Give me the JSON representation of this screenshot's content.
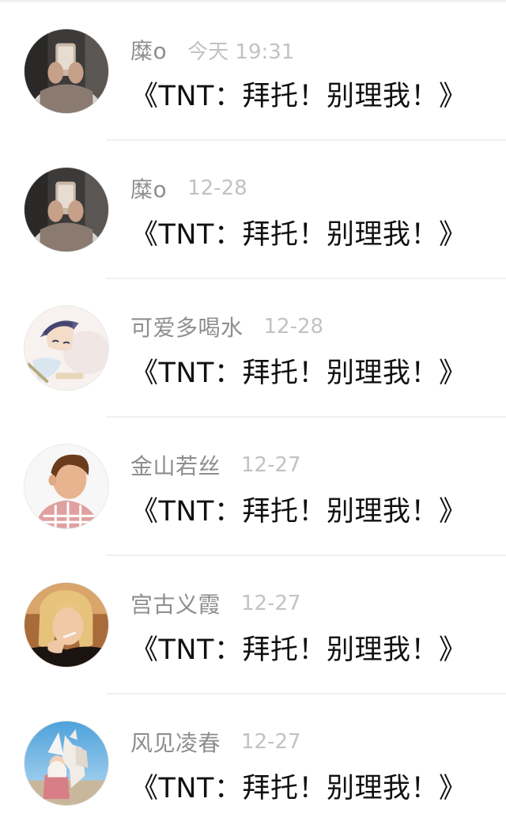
{
  "comments": [
    {
      "name": "糜o",
      "time": "今天 19:31",
      "message": "《TNT：拜托！别理我！》",
      "avatar": "avatar-photo-phone-selfie",
      "colors": {
        "bg": "#3f3d3b",
        "accent": "#b79a86"
      }
    },
    {
      "name": "糜o",
      "time": "12-28",
      "message": "《TNT：拜托！别理我！》",
      "avatar": "avatar-photo-phone-selfie",
      "colors": {
        "bg": "#3f3d3b",
        "accent": "#b79a86"
      }
    },
    {
      "name": "可爱多喝水",
      "time": "12-28",
      "message": "《TNT：拜托！别理我！》",
      "avatar": "avatar-anime-character",
      "colors": {
        "bg": "#f6f0ee",
        "accent": "#6a6f9a"
      }
    },
    {
      "name": "金山若丝",
      "time": "12-27",
      "message": "《TNT：拜托！别理我！》",
      "avatar": "avatar-photo-boy",
      "colors": {
        "bg": "#f6f6f6",
        "accent": "#d46a6a"
      }
    },
    {
      "name": "宫古义霞",
      "time": "12-27",
      "message": "《TNT：拜托！别理我！》",
      "avatar": "avatar-photo-woman-smoking",
      "colors": {
        "bg": "#2b1d14",
        "accent": "#e8b86e"
      }
    },
    {
      "name": "风见凌春",
      "time": "12-27",
      "message": "《TNT：拜托！别理我！》",
      "avatar": "avatar-photo-horse-rider",
      "colors": {
        "bg": "#8fc1e6",
        "accent": "#e9d7c4"
      }
    }
  ]
}
